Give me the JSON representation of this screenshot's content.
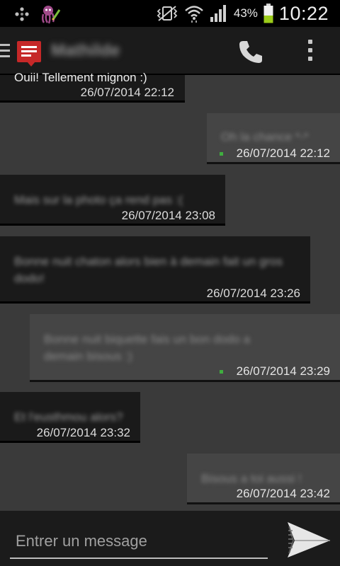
{
  "status": {
    "battery_percent": "43%",
    "battery_level": 0.43,
    "time": "10:22",
    "icons": [
      "app-notification-icon",
      "octopus-app-icon",
      "silent-vibrate-icon",
      "wifi-icon",
      "signal-icon",
      "battery-icon"
    ]
  },
  "actionbar": {
    "contact_name": "Mathilde",
    "icons": [
      "menu-icon",
      "sms-app-icon",
      "phone-icon",
      "overflow-menu-icon"
    ]
  },
  "messages": [
    {
      "direction": "in",
      "text": "Ouii! Tellement mignon :)",
      "time": "26/07/2014 22:12"
    },
    {
      "direction": "out",
      "text": "Oh la chance *-*",
      "time": "26/07/2014 22:12"
    },
    {
      "direction": "in",
      "text": "Mais sur la photo ça rend pas :(",
      "time": "26/07/2014 23:08"
    },
    {
      "direction": "in",
      "text": "Bonne nuit chaton alors bien à demain fait un gros dodo!",
      "time": "26/07/2014 23:26"
    },
    {
      "direction": "out",
      "text": "Bonne nuit biquette fais un bon dodo a demain bisous :)",
      "time": "26/07/2014 23:29"
    },
    {
      "direction": "in",
      "text": "Et l'eusthmou alors?",
      "time": "26/07/2014 23:32"
    },
    {
      "direction": "out",
      "text": "Bisous a toi aussi !",
      "time": "26/07/2014 23:42"
    }
  ],
  "composer": {
    "placeholder": "Entrer un message",
    "send_icon": "send-icon"
  },
  "colors": {
    "background": "#3a3a3a",
    "incoming_bubble": "#1a1a1a",
    "outgoing_bubble": "#454545",
    "sent_indicator": "#3fae3f",
    "app_red": "#c62828",
    "battery_green": "#9ccc1a"
  }
}
